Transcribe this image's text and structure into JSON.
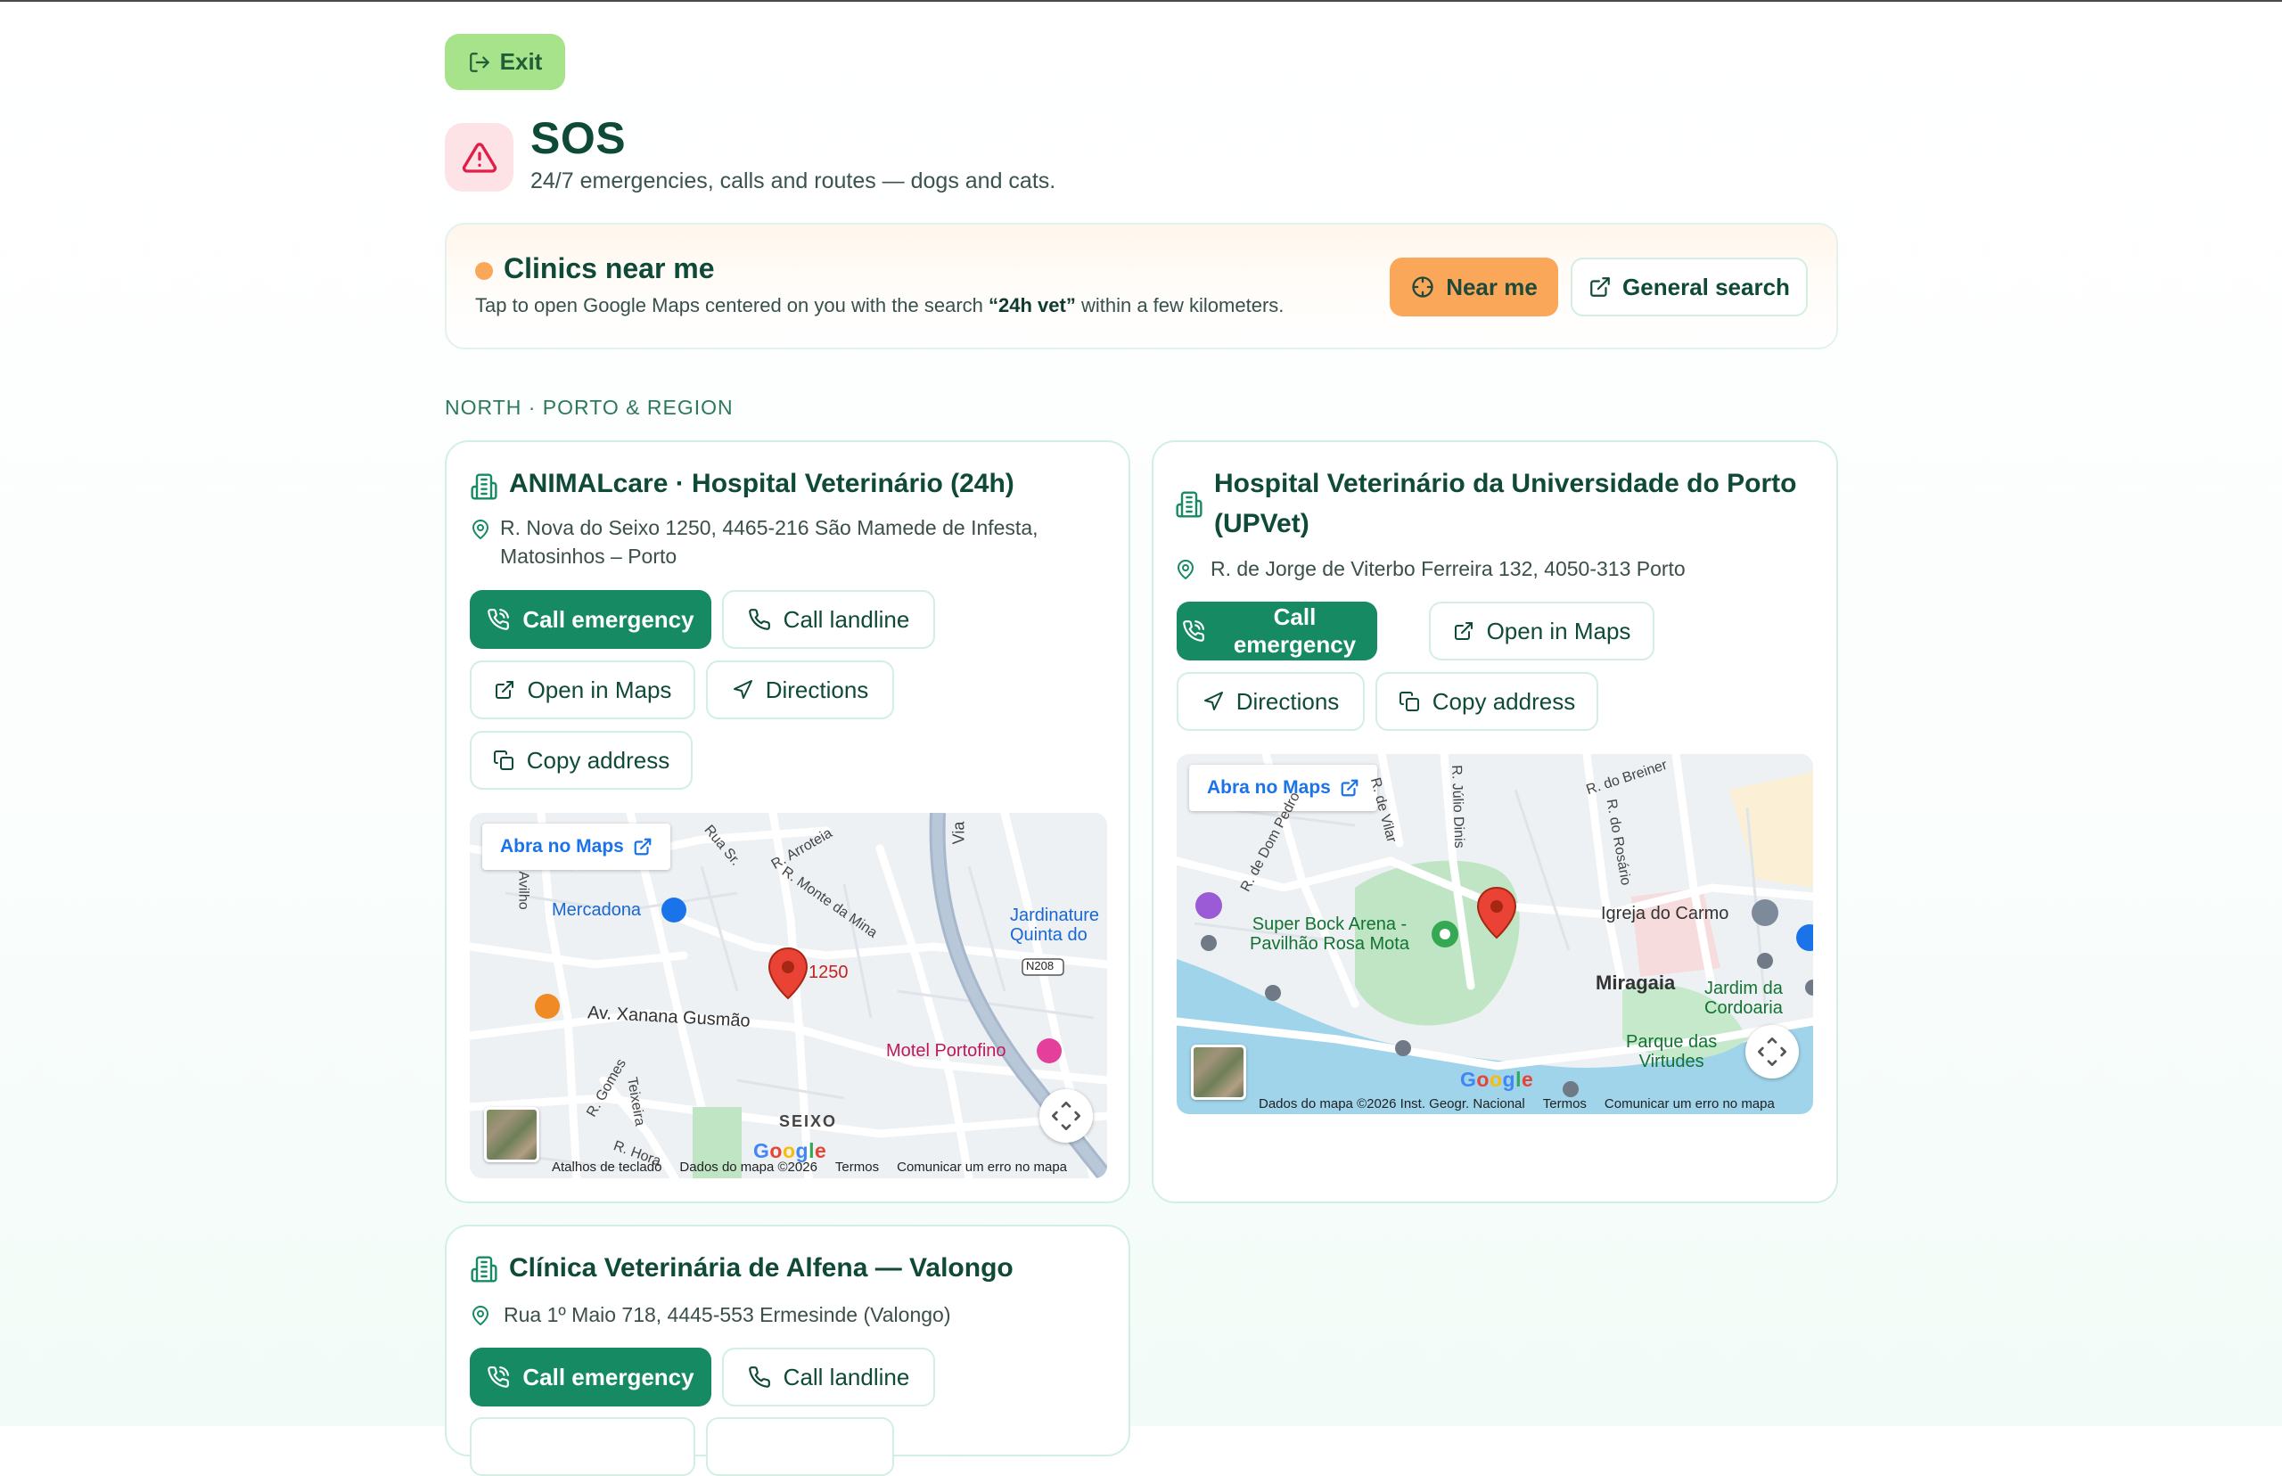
{
  "header": {
    "exit_label": "Exit",
    "title": "SOS",
    "subtitle": "24/7 emergencies, calls and routes — dogs and cats."
  },
  "near_panel": {
    "title": "Clinics near me",
    "desc_before": "Tap to open Google Maps centered on you with the search ",
    "desc_highlight": "“24h vet”",
    "desc_after": " within a few kilometers.",
    "near_me_label": "Near me",
    "general_search_label": "General search"
  },
  "section_label": "NORTH · PORTO & REGION",
  "clinics": [
    {
      "name": "ANIMALcare · Hospital Veterinário (24h)",
      "address_line1": "R. Nova do Seixo 1250, 4465-216 São Mamede de Infesta,",
      "address_line2": "Matosinhos – Porto",
      "call_emergency": "Call emergency",
      "call_landline": "Call landline",
      "open_in_maps": "Open in Maps",
      "directions": "Directions",
      "copy_address": "Copy address",
      "map": {
        "open_link": "Abra no Maps",
        "labels": {
          "mercadona": "Mercadona",
          "jardinature1": "Jardinature",
          "jardinature2": "Quinta do",
          "n208": "N208",
          "number": "1250",
          "xanana": "Av. Xanana Gusmão",
          "motel": "Motel Portofino",
          "seixo": "SEIXO",
          "rua_sr": "Rua Sr.",
          "arroteia": "R. Arroteia",
          "monte_mina": "R. Monte da Mina",
          "gomes": "R. Gomes",
          "teixeira": "Teixeira",
          "hora": "R. Hora",
          "avilho": "Avilho",
          "via": "Via"
        },
        "footer": {
          "shortcuts": "Atalhos de teclado",
          "data": "Dados do mapa ©2026",
          "terms": "Termos",
          "report": "Comunicar um erro no mapa"
        },
        "google": "Google"
      }
    },
    {
      "name_line1": "Hospital Veterinário da Universidade do Porto",
      "name_line2": "(UPVet)",
      "address": "R. de Jorge de Viterbo Ferreira 132, 4050-313 Porto",
      "call_emergency": "Call emergency",
      "open_in_maps": "Open in Maps",
      "directions": "Directions",
      "copy_address": "Copy address",
      "map": {
        "open_link": "Abra no Maps",
        "labels": {
          "super_bock1": "Super Bock Arena -",
          "super_bock2": "Pavilhão Rosa Mota",
          "igreja": "Igreja do Carmo",
          "miragaia": "Miragaia",
          "jardim1": "Jardim da",
          "jardim2": "Cordoaria",
          "parque1": "Parque das",
          "parque2": "Virtudes",
          "dom_pedro": "R. de Dom Pedro",
          "julio_dinis": "R. Júlio Dinis",
          "vilar": "R. de Vilar",
          "breiner": "R. do Breiner",
          "rosario": "R. do Rosário"
        },
        "footer": {
          "data": "Dados do mapa ©2026 Inst. Geogr. Nacional",
          "terms": "Termos",
          "report": "Comunicar um erro no mapa"
        },
        "google": "Google"
      }
    },
    {
      "name": "Clínica Veterinária de Alfena — Valongo",
      "address": "Rua 1º Maio 718, 4445-553 Ermesinde (Valongo)",
      "call_emergency": "Call emergency",
      "call_landline": "Call landline"
    }
  ],
  "colors": {
    "primary": "#168a62",
    "accent_orange": "#fba75a",
    "exit_green": "#a6e38a",
    "heading": "#0f4a39",
    "danger_bg": "#fde2e6",
    "danger_icon": "#e11d48"
  }
}
